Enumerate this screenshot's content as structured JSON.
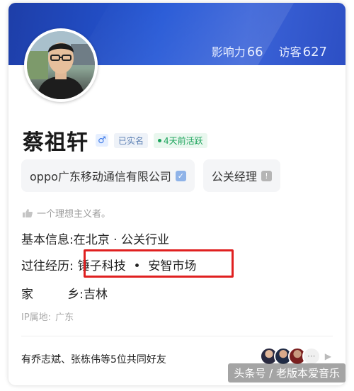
{
  "header": {
    "influence_label": "影响力",
    "influence_value": "66",
    "visitors_label": "访客",
    "visitors_value": "627"
  },
  "profile": {
    "name": "蔡祖轩",
    "gender_symbol": "♂",
    "verified_tag": "已实名",
    "active_tag": "4天前活跃",
    "company": "oppo广东移动通信有限公司",
    "title": "公关经理",
    "motto": "一个理想主义者。"
  },
  "info": {
    "basic_label": "基本信息:",
    "basic_value": "在北京 · 公关行业",
    "past_label": "过往经历:",
    "past_value": "锤子科技  •  安智市场",
    "hometown_label_1": "家",
    "hometown_label_2": "乡:",
    "hometown_value": "吉林",
    "ip_label": "IP属地:",
    "ip_value": "广东"
  },
  "friends": {
    "text": "有乔志斌、张栋伟等5位共同好友",
    "more": "···"
  },
  "watermark": "头条号 / 老版本爱音乐",
  "colors": {
    "banner": "#2457d6",
    "highlight_border": "#e02020",
    "active_green": "#1aa35a"
  }
}
